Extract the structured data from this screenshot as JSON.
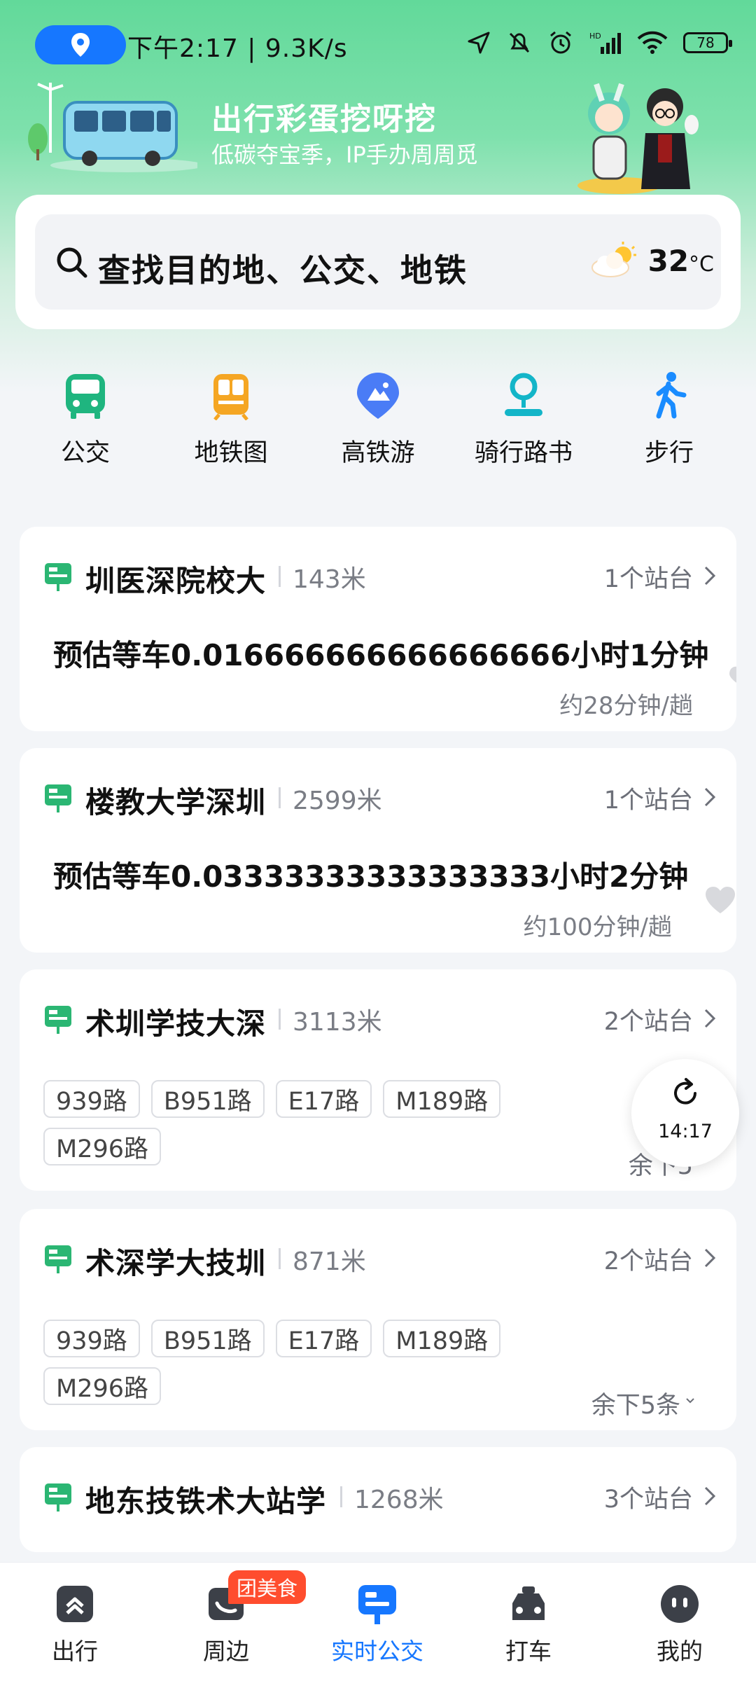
{
  "status_bar": {
    "text": "下午2:17 | 9.3K/s",
    "battery": "78"
  },
  "banner": {
    "title": "出行彩蛋挖呀挖",
    "subtitle": "低碳夺宝季，IP手办周周觅"
  },
  "search": {
    "placeholder": "查找目的地、公交、地铁"
  },
  "weather": {
    "temp": "32",
    "unit": "°C"
  },
  "quick_nav": [
    {
      "label": "公交",
      "icon": "bus-icon",
      "color": "#1fb57f"
    },
    {
      "label": "地铁图",
      "icon": "metro-icon",
      "color": "#f5a623"
    },
    {
      "label": "高铁游",
      "icon": "mountain-pin-icon",
      "color": "#4a7cf6"
    },
    {
      "label": "骑行路书",
      "icon": "ride-pin-icon",
      "color": "#13b5c8"
    },
    {
      "label": "步行",
      "icon": "walk-icon",
      "color": "#1a8cff"
    }
  ],
  "stations": [
    {
      "name": "圳医深院校大",
      "distance": "143米",
      "platforms": "1个站台",
      "wait": "预估等车0.016666666666666666小时1分钟",
      "frequency": "约28分钟/趟"
    },
    {
      "name": "楼教大学深圳",
      "distance": "2599米",
      "platforms": "1个站台",
      "wait": "预估等车0.03333333333333333小时2分钟",
      "frequency": "约100分钟/趟"
    },
    {
      "name": "术圳学技大深",
      "distance": "3113米",
      "platforms": "2个站台",
      "routes": [
        "939路",
        "B951路",
        "E17路",
        "M189路",
        "M296路"
      ],
      "remaining": "余下5"
    },
    {
      "name": "术深学大技圳",
      "distance": "871米",
      "platforms": "2个站台",
      "routes": [
        "939路",
        "B951路",
        "E17路",
        "M189路",
        "M296路"
      ],
      "remaining": "余下5条"
    },
    {
      "name": "地东技铁术大站学",
      "distance": "1268米",
      "platforms": "3个站台"
    }
  ],
  "refresh": {
    "time": "14:17"
  },
  "bottom_nav": [
    {
      "label": "出行",
      "icon": "travel-icon",
      "active": false
    },
    {
      "label": "周边",
      "icon": "nearby-icon",
      "active": false,
      "badge": "团美食"
    },
    {
      "label": "实时公交",
      "icon": "realtime-bus-icon",
      "active": true
    },
    {
      "label": "打车",
      "icon": "taxi-icon",
      "active": false
    },
    {
      "label": "我的",
      "icon": "profile-icon",
      "active": false
    }
  ],
  "colors": {
    "accent": "#1677ff",
    "header_green": "#62d99a",
    "station_icon": "#2bb673"
  }
}
